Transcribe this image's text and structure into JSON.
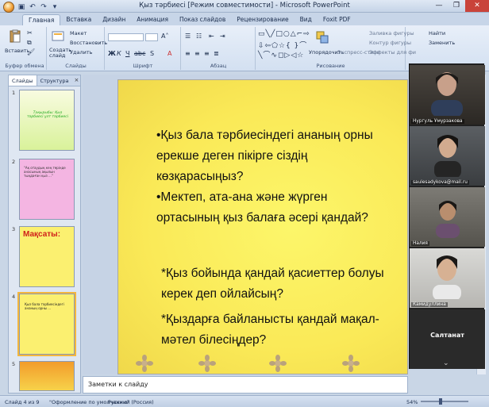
{
  "window": {
    "title": "Қыз тәрбиесі [Режим совместимости] - Microsoft PowerPoint",
    "controls": [
      "—",
      "❐",
      "✕"
    ]
  },
  "ribbon": {
    "tabs": [
      "Главная",
      "Вставка",
      "Дизайн",
      "Анимация",
      "Показ слайдов",
      "Рецензирование",
      "Вид",
      "Foxit PDF"
    ],
    "active_tab": "Главная",
    "clipboard": {
      "label": "Буфер обмена",
      "paste": "Вставить",
      "cut": "Вырезать",
      "copy": "Копировать",
      "format": "Формат по образцу"
    },
    "slides": {
      "label": "Слайды",
      "new_slide": "Создать слайд",
      "layout": "Макет",
      "reset": "Восстановить",
      "delete": "Удалить"
    },
    "font": {
      "label": "Шрифт"
    },
    "paragraph": {
      "label": "Абзац"
    },
    "drawing": {
      "label": "Рисование",
      "arrange": "Упорядочить",
      "quick_styles": "Экспресс-стили",
      "fill": "Заливка фигуры",
      "outline": "Контур фигуры",
      "effects": "Эффекты для фи"
    },
    "editing": {
      "find": "Найти",
      "replace": "Заменить",
      "select": "Выделить"
    }
  },
  "left_panel": {
    "tabs": [
      "Слайды",
      "Структура"
    ],
    "active_tab": "Слайды",
    "close": "×",
    "slides": [
      {
        "num": "1",
        "text": "Тақырыбы: Қыз тәрбиесі ұлт тәрбиесі",
        "bg": "#e7f7b5"
      },
      {
        "num": "2",
        "text": "\"Ақ отаудың кең төрінде анасының ақылын тыңдаған қыз ...\"",
        "bg": "#f4b5e2"
      },
      {
        "num": "3",
        "text": "Мақсаты:",
        "bg": "#fbf070"
      },
      {
        "num": "4",
        "text": "Қыз бала тәрбиесіндегі ананың орны ...",
        "bg": "#fbf070"
      },
      {
        "num": "5",
        "text": "",
        "bg": "#f2b13a"
      }
    ]
  },
  "slide": {
    "lines": [
      "•Қыз бала тәрбиесіндегі ананың орны",
      "ерекше деген пікірге сіздің",
      "көзқарасыңыз?",
      "•Мектеп, ата-ана және жүрген",
      "ортасының қыз балаға әсері қандай?",
      "*Қыз бойында қандай қасиеттер болуы",
      "керек деп ойлайсың?",
      "*Қыздарға байланысты қандай мақал-",
      "мәтел білесіңдер?"
    ]
  },
  "notes": {
    "placeholder": "Заметки к слайду"
  },
  "status": {
    "slide": "Слайд 4 из 9",
    "theme": "\"Оформление по умолчанию\"",
    "lang": "Русский (Россия)",
    "zoom": "54%"
  },
  "video_call": {
    "participants": [
      {
        "name": "Нургуль Ұмурзакова"
      },
      {
        "name": "saulesadykova@mail.ru"
      },
      {
        "name": "Налия"
      },
      {
        "name": "Камидуллина"
      },
      {
        "name": "Салтанат"
      }
    ],
    "more": "⌄"
  }
}
